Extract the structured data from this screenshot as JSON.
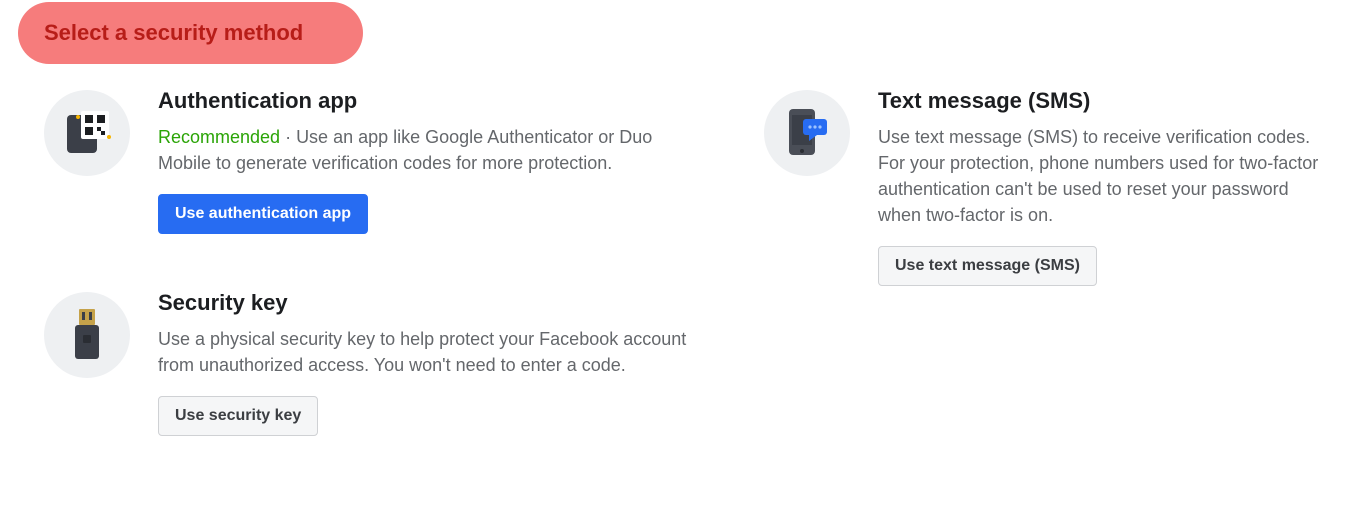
{
  "header": {
    "title": "Select a security method"
  },
  "methods": {
    "auth_app": {
      "title": "Authentication app",
      "recommended": "Recommended",
      "sep": " · ",
      "desc": "Use an app like Google Authenticator or Duo Mobile to generate verification codes for more protection.",
      "button": "Use authentication app",
      "icon": "auth-app-icon"
    },
    "sms": {
      "title": "Text message (SMS)",
      "desc": "Use text message (SMS) to receive verification codes. For your protection, phone numbers used for two-factor authentication can't be used to reset your password when two-factor is on.",
      "button": "Use text message (SMS)",
      "icon": "phone-sms-icon"
    },
    "security_key": {
      "title": "Security key",
      "desc": "Use a physical security key to help protect your Facebook account from unauthorized access. You won't need to enter a code.",
      "button": "Use security key",
      "icon": "usb-key-icon"
    }
  }
}
